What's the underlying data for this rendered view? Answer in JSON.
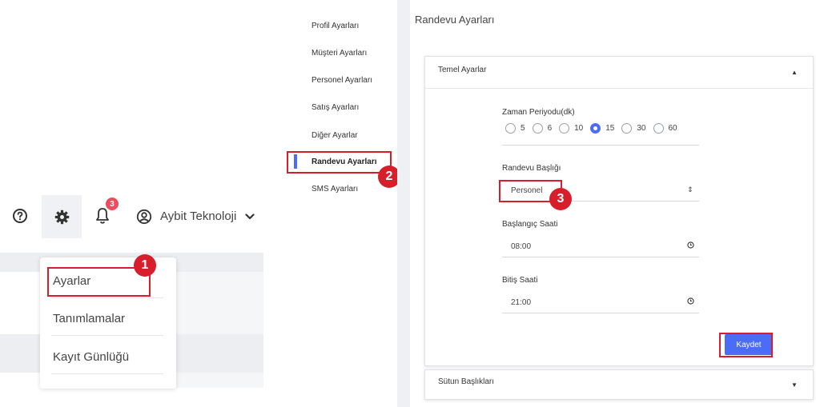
{
  "header": {
    "user_name": "Aybit Teknoloji",
    "notification_count": "3",
    "icons": [
      "help-circle-icon",
      "gear-icon",
      "bell-icon",
      "user-circle-icon",
      "chevron-down-icon"
    ]
  },
  "settings_menu": {
    "items": [
      {
        "label": "Ayarlar"
      },
      {
        "label": "Tanımlamalar"
      },
      {
        "label": "Kayıt Günlüğü"
      }
    ]
  },
  "markers": [
    "1",
    "2",
    "3"
  ],
  "settings_nav": {
    "items": [
      {
        "label": "Profil Ayarları"
      },
      {
        "label": "Müşteri Ayarları"
      },
      {
        "label": "Personel Ayarları"
      },
      {
        "label": "Satış Ayarları"
      },
      {
        "label": "Diğer Ayarlar"
      },
      {
        "label": "Randevu Ayarları"
      },
      {
        "label": "SMS Ayarları"
      }
    ],
    "active_index": 5
  },
  "main": {
    "page_title": "Randevu Ayarları",
    "temel_ayarlar": {
      "title": "Temel Ayarlar",
      "time_period": {
        "label": "Zaman Periyodu(dk)",
        "options": [
          "5",
          "6",
          "10",
          "15",
          "30",
          "60"
        ],
        "selected": "15"
      },
      "appointment_title": {
        "label": "Randevu Başlığı",
        "value": "Personel"
      },
      "start_time": {
        "label": "Başlangıç Saati",
        "value": "08:00"
      },
      "end_time": {
        "label": "Bitiş Saati",
        "value": "21:00"
      },
      "save_label": "Kaydet"
    },
    "column_headers": {
      "title": "Sütun Başlıkları"
    }
  },
  "colors": {
    "accent": "#4a6cf7",
    "highlight": "#d61f2b",
    "badge": "#ef4b5f"
  }
}
